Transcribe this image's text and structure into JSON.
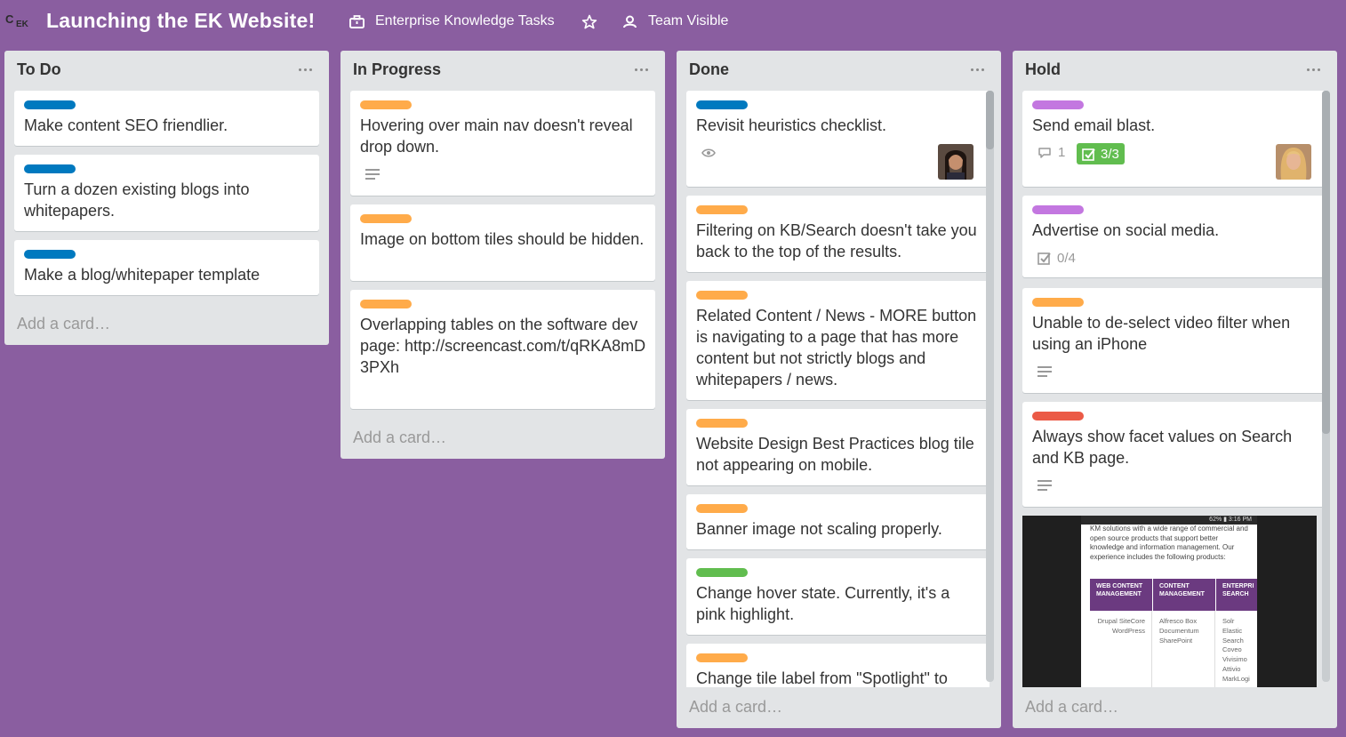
{
  "header": {
    "board_title": "Launching the EK Website!",
    "organization": "Enterprise Knowledge Tasks",
    "visibility": "Team Visible"
  },
  "colors": {
    "background": "#8a5ea0",
    "blue": "#0079bf",
    "orange": "#ffab4a",
    "purple": "#c377e0",
    "red": "#eb5a46",
    "green": "#61bd4f"
  },
  "add_card_label": "Add a card…",
  "lists": [
    {
      "title": "To Do",
      "cards": [
        {
          "label": "blue",
          "text": "Make content SEO friendlier."
        },
        {
          "label": "blue",
          "text": "Turn a dozen existing blogs into whitepapers."
        },
        {
          "label": "blue",
          "text": "Make a blog/whitepaper template"
        }
      ]
    },
    {
      "title": "In Progress",
      "cards": [
        {
          "label": "orange",
          "text": "Hovering over main nav doesn't reveal drop down."
        },
        {
          "label": "orange",
          "text": "Image on bottom tiles should be hidden."
        },
        {
          "label": "orange",
          "text": "Overlapping tables on the software dev page: http://screencast.com/t/qRKA8mD3PXh"
        }
      ]
    },
    {
      "title": "Done",
      "cards": [
        {
          "label": "blue",
          "text": "Revisit heuristics checklist."
        },
        {
          "label": "orange",
          "text": "Filtering on KB/Search doesn't take you back to the top of the results."
        },
        {
          "label": "orange",
          "text": "Related Content / News - MORE button is navigating to a page that has more content but not strictly blogs and whitepapers / news."
        },
        {
          "label": "orange",
          "text": "Website Design Best Practices blog tile not appearing on mobile."
        },
        {
          "label": "orange",
          "text": "Banner image not scaling properly."
        },
        {
          "label": "green",
          "text": "Change hover state. Currently, it's a pink highlight."
        },
        {
          "label": "orange",
          "text": "Change tile label from \"Spotlight\" to"
        }
      ]
    },
    {
      "title": "Hold",
      "cards": [
        {
          "label": "purple",
          "text": "Send email blast.",
          "comments": "1",
          "checklist": "3/3"
        },
        {
          "label": "purple",
          "text": "Advertise on social media.",
          "checklist": "0/4"
        },
        {
          "label": "orange",
          "text": "Unable to de-select video filter when using an iPhone"
        },
        {
          "label": "red",
          "text": "Always show facet values on Search and KB page."
        }
      ],
      "attachment": {
        "status_bar": "62% ▮ 3:16 PM",
        "intro": "KM solutions with a wide range of commercial and open source products that support better knowledge and information management. Our experience includes the following products:",
        "columns": [
          {
            "head": "WEB CONTENT MANAGEMENT",
            "items": "Drupal SiteCore WordPress"
          },
          {
            "head": "CONTENT MANAGEMENT",
            "items": "Alfresco Box Documentum SharePoint"
          },
          {
            "head": "ENTERPRI SEARCH",
            "items": "Solr Elastic Search Coveo Vivisimo Attivio MarkLogi"
          }
        ]
      }
    }
  ]
}
